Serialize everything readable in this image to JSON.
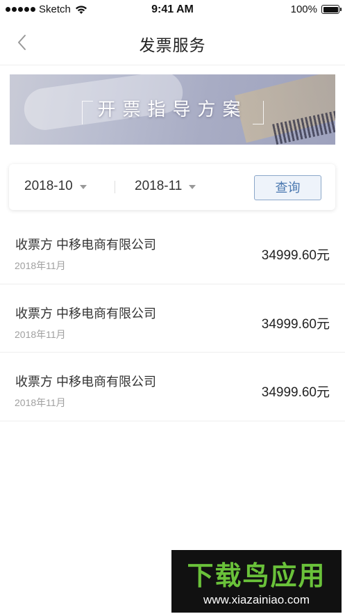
{
  "status_bar": {
    "carrier": "Sketch",
    "time": "9:41 AM",
    "battery": "100%"
  },
  "nav": {
    "title": "发票服务"
  },
  "banner": {
    "title": "开票指导方案"
  },
  "filter": {
    "start_date": "2018-10",
    "end_date": "2018-11",
    "query_label": "查询"
  },
  "invoices": [
    {
      "payee": "收票方 中移电商有限公司",
      "date": "2018年11月",
      "amount": "34999.60元"
    },
    {
      "payee": "收票方 中移电商有限公司",
      "date": "2018年11月",
      "amount": "34999.60元"
    },
    {
      "payee": "收票方 中移电商有限公司",
      "date": "2018年11月",
      "amount": "34999.60元"
    }
  ],
  "watermark": {
    "logo": "下载鸟应用",
    "url": "www.xiazainiao.com"
  }
}
